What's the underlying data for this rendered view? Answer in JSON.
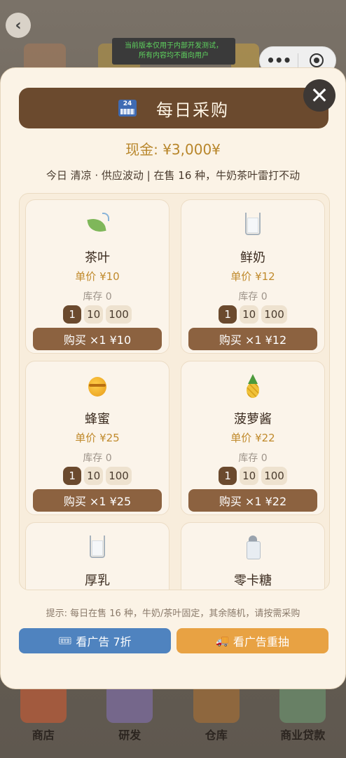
{
  "background": {
    "back_icon": "chevron-left-icon",
    "dev_banner": [
      "当前版本仅用于内部开发测试，",
      "所有内容均不面向用户"
    ],
    "capsule": {
      "more_icon": "more-dots-icon",
      "close_icon": "target-icon"
    },
    "nav": [
      {
        "label": "商店",
        "icon": "store-icon"
      },
      {
        "label": "研发",
        "icon": "test-tube-icon"
      },
      {
        "label": "仓库",
        "icon": "warehouse-icon"
      },
      {
        "label": "商业贷款",
        "icon": "loan-icon"
      }
    ]
  },
  "modal": {
    "title": "每日采购",
    "title_icon": "24h-store-icon",
    "close_icon": "close-icon",
    "cash": "现金: ¥3,000¥",
    "info": "今日 清凉 · 供应波动 | 在售 16 种，牛奶茶叶雷打不动",
    "goods": [
      {
        "name": "茶叶",
        "icon": "tea-leaf-icon",
        "price": "单价 ¥10",
        "stock": "库存 0",
        "qty": [
          "1",
          "10",
          "100"
        ],
        "selected": 0,
        "buy": "购买 ×1 ¥10"
      },
      {
        "name": "鲜奶",
        "icon": "milk-glass-icon",
        "price": "单价 ¥12",
        "stock": "库存 0",
        "qty": [
          "1",
          "10",
          "100"
        ],
        "selected": 0,
        "buy": "购买 ×1 ¥12"
      },
      {
        "name": "蜂蜜",
        "icon": "honey-pot-icon",
        "price": "单价 ¥25",
        "stock": "库存 0",
        "qty": [
          "1",
          "10",
          "100"
        ],
        "selected": 0,
        "buy": "购买 ×1 ¥25"
      },
      {
        "name": "菠萝酱",
        "icon": "pineapple-icon",
        "price": "单价 ¥22",
        "stock": "库存 0",
        "qty": [
          "1",
          "10",
          "100"
        ],
        "selected": 0,
        "buy": "购买 ×1 ¥22"
      },
      {
        "name": "厚乳",
        "icon": "milk-glass-icon"
      },
      {
        "name": "零卡糖",
        "icon": "salt-shaker-icon"
      }
    ],
    "hint": "提示: 每日在售 16 种，牛奶/茶叶固定，其余随机，请按需采购",
    "ad_discount": {
      "label": "看广告 7折",
      "icon": "ticket-icon"
    },
    "ad_redraw": {
      "label": "看广告重抽",
      "icon": "truck-icon"
    }
  }
}
